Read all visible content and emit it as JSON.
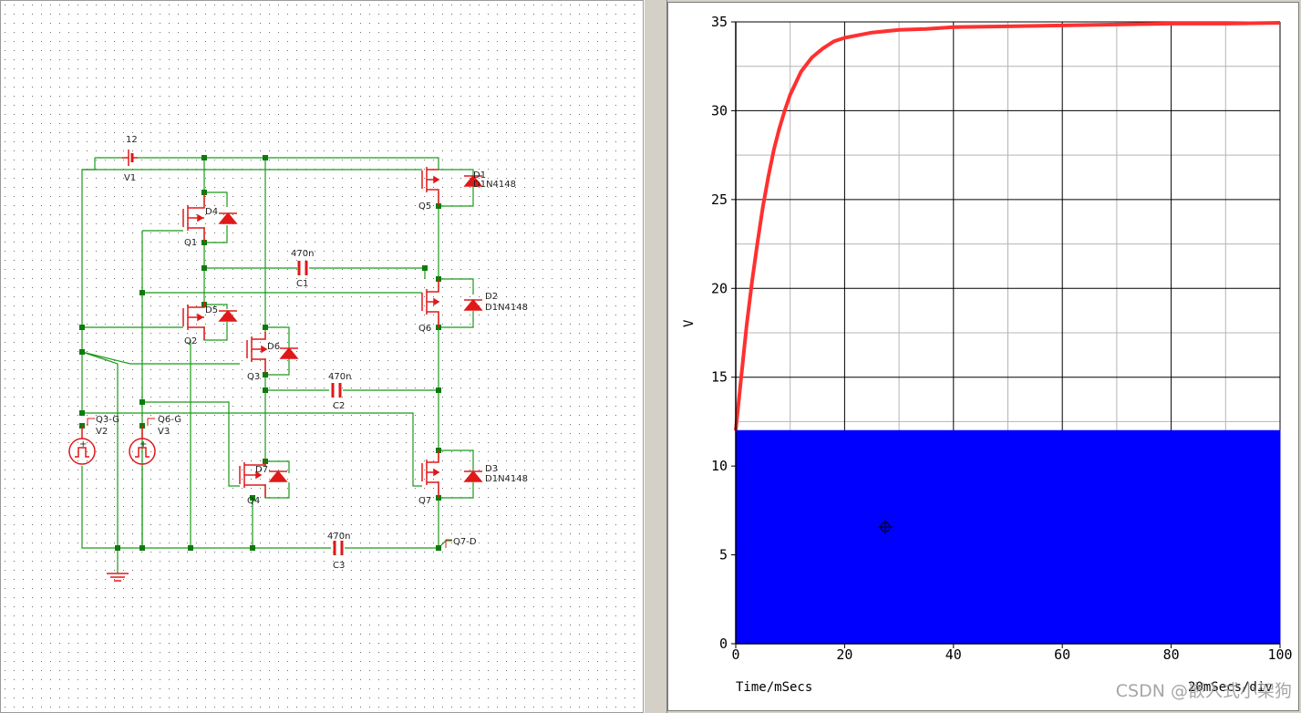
{
  "schematic": {
    "battery": {
      "ref": "V1",
      "value": "12"
    },
    "capacitors": [
      {
        "ref": "C1",
        "value": "470n"
      },
      {
        "ref": "C2",
        "value": "470n"
      },
      {
        "ref": "C3",
        "value": "470n"
      }
    ],
    "mosfets": [
      "Q1",
      "Q2",
      "Q3",
      "Q4",
      "Q5",
      "Q6",
      "Q7"
    ],
    "diodes": [
      {
        "ref": "D1",
        "part": "D1N4148"
      },
      {
        "ref": "D2",
        "part": "D1N4148"
      },
      {
        "ref": "D3",
        "part": "D1N4148"
      },
      {
        "ref": "D4",
        "part": ""
      },
      {
        "ref": "D5",
        "part": ""
      },
      {
        "ref": "D6",
        "part": ""
      },
      {
        "ref": "D7",
        "part": ""
      }
    ],
    "sources": [
      {
        "ref": "V2",
        "probe": "Q3-G"
      },
      {
        "ref": "V3",
        "probe": "Q6-G"
      }
    ],
    "output_probe": "Q7-D",
    "colors": {
      "wire": "#1a9a1a",
      "component": "#e01818",
      "node": "#0e7a0e",
      "grid_dot": "#6a6a6a"
    }
  },
  "chart_data": {
    "type": "line",
    "x": [
      0,
      1,
      2,
      3,
      4,
      5,
      6,
      7,
      8,
      9,
      10,
      12,
      14,
      16,
      18,
      20,
      25,
      30,
      35,
      40,
      50,
      60,
      70,
      80,
      90,
      100
    ],
    "series": [
      {
        "values": [
          12,
          15.0,
          17.9,
          20.4,
          22.6,
          24.6,
          26.3,
          27.8,
          29.0,
          30.0,
          30.9,
          32.2,
          33.0,
          33.5,
          33.9,
          34.1,
          34.4,
          34.55,
          34.6,
          34.7,
          34.75,
          34.8,
          34.85,
          34.9,
          34.9,
          34.95
        ],
        "color": "#ff3030"
      },
      {
        "values": [
          12,
          12,
          12,
          12,
          12,
          12,
          12,
          12,
          12,
          12,
          12,
          12,
          12,
          12,
          12,
          12,
          12,
          12,
          12,
          12,
          12,
          12,
          12,
          12,
          12,
          12
        ],
        "color": "#0000ff",
        "fill": true
      }
    ],
    "xlim": [
      0,
      100
    ],
    "ylim": [
      0,
      35
    ],
    "xticks": [
      0,
      20,
      40,
      60,
      80,
      100
    ],
    "yticks": [
      0,
      5,
      10,
      15,
      20,
      25,
      30,
      35
    ],
    "xlabel": "Time/mSecs",
    "ylabel": "V",
    "scale_label": "20mSecs/div",
    "grid": true
  },
  "watermark": "CSDN @嵌入式小架狗"
}
